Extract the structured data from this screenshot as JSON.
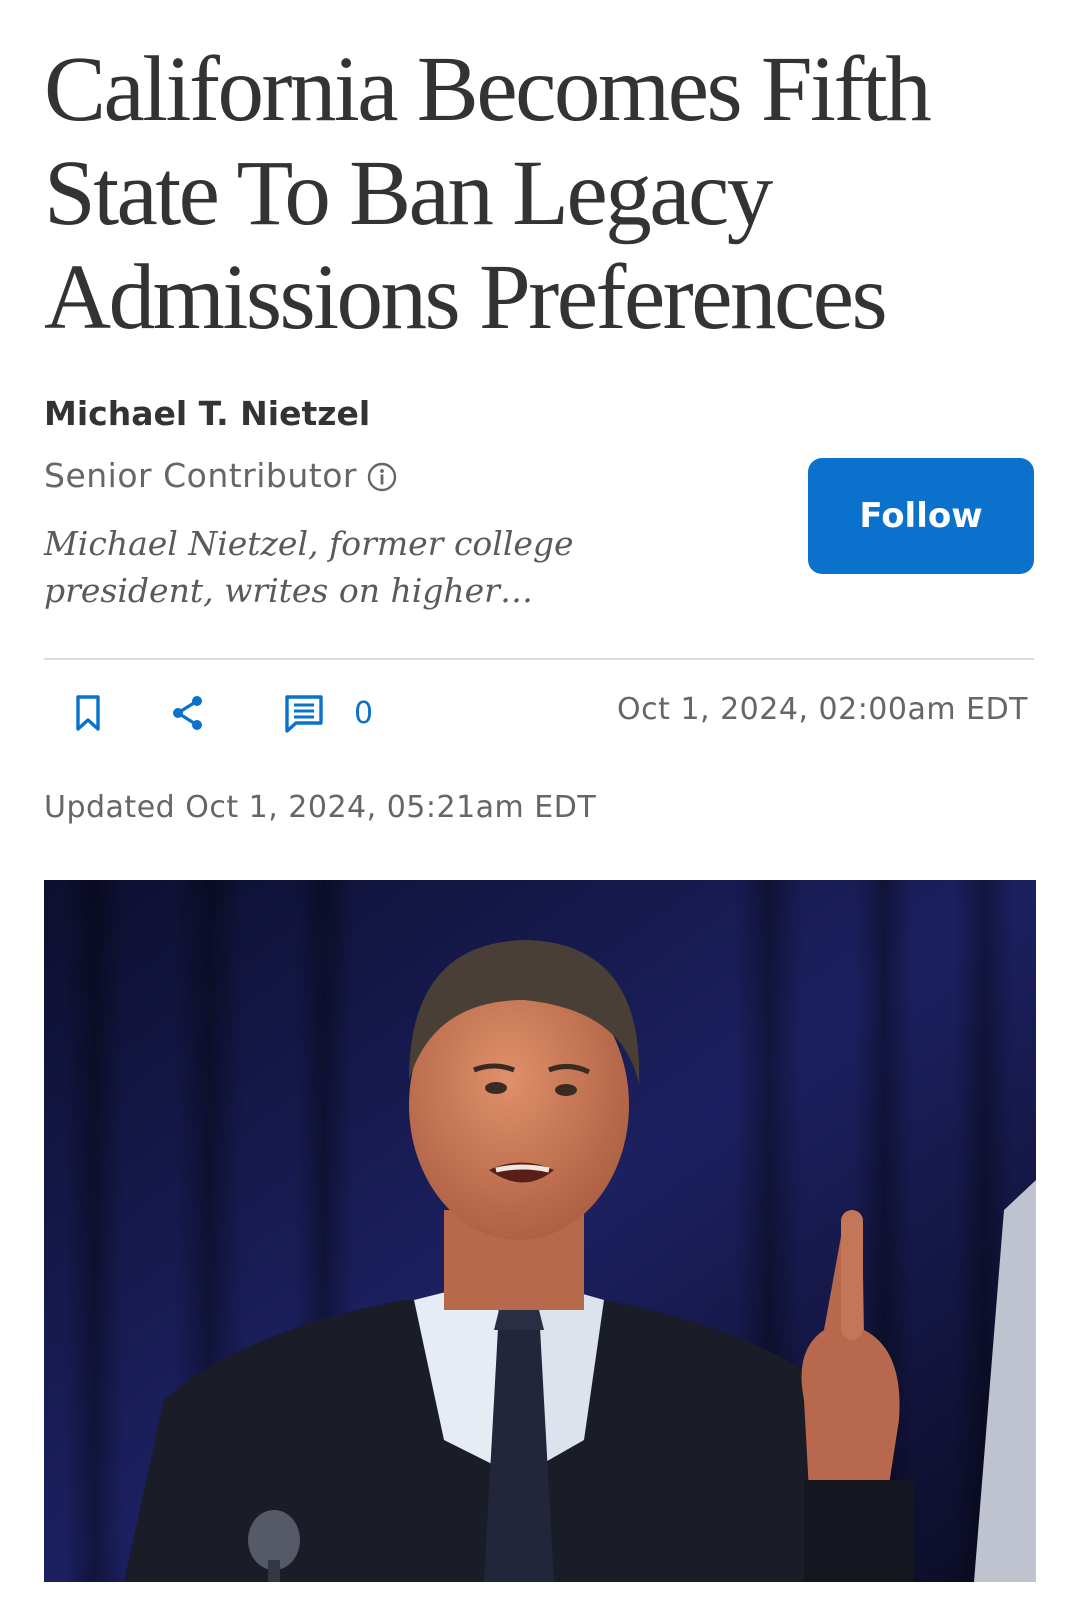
{
  "article": {
    "headline": "California Becomes Fifth State To Ban Legacy Admissions Preferences",
    "author": {
      "name": "Michael T. Nietzel",
      "role": "Senior Contributor",
      "bio": "Michael Nietzel, former college president, writes on higher…"
    },
    "follow_label": "Follow",
    "actions": {
      "bookmark_icon": "bookmark-icon",
      "share_icon": "share-icon",
      "comment_icon": "comment-icon",
      "comment_count": "0"
    },
    "published": "Oct 1, 2024, 02:00am EDT",
    "updated": "Updated Oct 1, 2024, 05:21am EDT"
  },
  "colors": {
    "accent": "#0a72cc",
    "headline_text": "#333333",
    "meta_text": "#666666",
    "divider": "#dcdcdc"
  }
}
